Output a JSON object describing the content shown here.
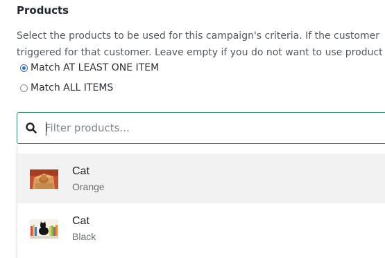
{
  "section": {
    "title": "Products",
    "description_lines": [
      "Select the products to be used for this campaign's criteria. If the customer",
      "triggered for that customer. Leave empty if you do not want to use product"
    ]
  },
  "match_options": [
    {
      "label": "Match AT LEAST ONE ITEM",
      "selected": true
    },
    {
      "label": "Match ALL ITEMS",
      "selected": false
    }
  ],
  "search": {
    "placeholder": "Filter products...",
    "value": "",
    "icon": "search-icon"
  },
  "products": [
    {
      "name": "Cat",
      "variant": "Orange",
      "thumbnail": "orange-cat-in-box",
      "highlighted": true
    },
    {
      "name": "Cat",
      "variant": "Black",
      "thumbnail": "black-cat-with-books",
      "highlighted": false
    }
  ],
  "colors": {
    "accent_radio": "#2674e0",
    "focus_border": "#2e8a66",
    "highlight_row": "#f2f2f2"
  }
}
